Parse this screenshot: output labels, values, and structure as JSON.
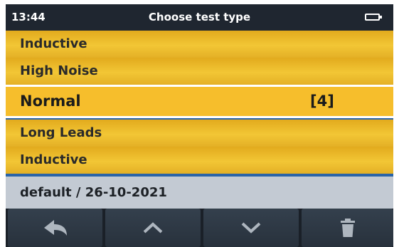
{
  "status": {
    "time": "13:44",
    "title": "Choose test type",
    "battery_icon": "battery-icon"
  },
  "list": {
    "items": [
      {
        "label": "Inductive"
      },
      {
        "label": "High Noise"
      },
      {
        "label": "Normal",
        "count": "[4]",
        "selected": true
      },
      {
        "label": "Long Leads"
      },
      {
        "label": "Inductive"
      }
    ]
  },
  "info": {
    "text": "default / 26-10-2021"
  },
  "toolbar": {
    "buttons": [
      {
        "icon": "back-arrow-icon"
      },
      {
        "icon": "chevron-up-icon"
      },
      {
        "icon": "chevron-down-icon"
      },
      {
        "icon": "trash-icon"
      }
    ]
  },
  "colors": {
    "accent": "#f6be2c",
    "header": "#1f2630",
    "separator": "#2a64a8",
    "info_bar": "#c3cad3"
  }
}
